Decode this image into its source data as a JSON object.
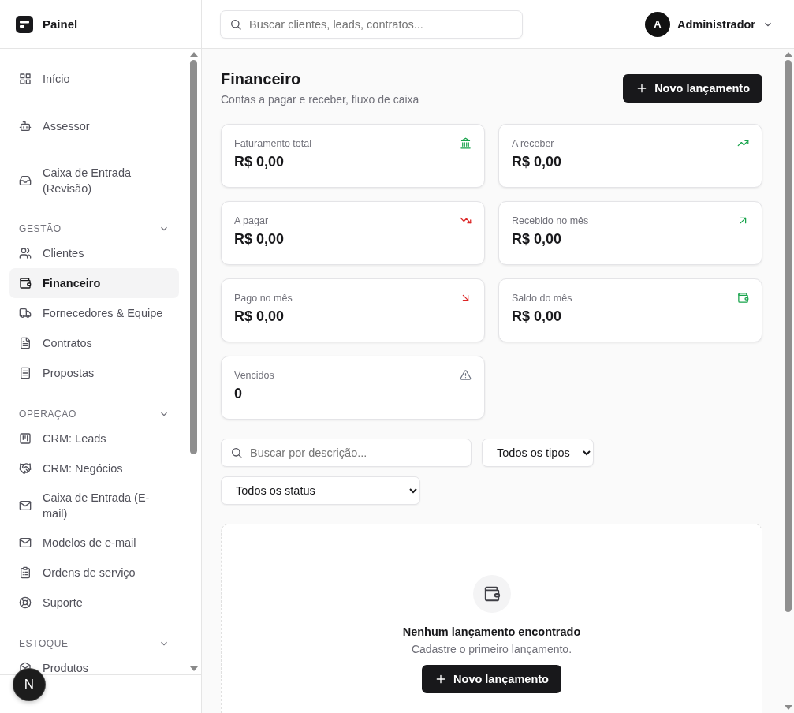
{
  "brand": {
    "name": "Painel"
  },
  "search": {
    "placeholder": "Buscar clientes, leads, contratos..."
  },
  "user": {
    "initial": "A",
    "name": "Administrador"
  },
  "nav": {
    "top_items": [
      {
        "label": "Início",
        "selected": false
      },
      {
        "label": "Assessor",
        "selected": false
      },
      {
        "label": "Caixa de Entrada (Revisão)",
        "selected": false
      }
    ],
    "sections": [
      {
        "title": "GESTÃO",
        "expanded": true,
        "items": [
          {
            "label": "Clientes",
            "selected": false
          },
          {
            "label": "Financeiro",
            "selected": true
          },
          {
            "label": "Fornecedores & Equipe",
            "selected": false
          },
          {
            "label": "Contratos",
            "selected": false
          },
          {
            "label": "Propostas",
            "selected": false
          }
        ]
      },
      {
        "title": "OPERAÇÃO",
        "expanded": true,
        "items": [
          {
            "label": "CRM: Leads",
            "selected": false
          },
          {
            "label": "CRM: Negócios",
            "selected": false
          },
          {
            "label": "Caixa de Entrada (E-mail)",
            "selected": false
          },
          {
            "label": "Modelos de e-mail",
            "selected": false
          },
          {
            "label": "Ordens de serviço",
            "selected": false
          },
          {
            "label": "Suporte",
            "selected": false
          }
        ]
      },
      {
        "title": "ESTOQUE",
        "expanded": true,
        "items": [
          {
            "label": "Produtos",
            "selected": false
          }
        ]
      }
    ]
  },
  "dev_badge": "N",
  "page": {
    "title": "Financeiro",
    "subtitle": "Contas a pagar e receber, fluxo de caixa",
    "new_button": "Novo lançamento"
  },
  "stats": [
    {
      "label": "Faturamento total",
      "value": "R$ 0,00"
    },
    {
      "label": "A receber",
      "value": "R$ 0,00"
    },
    {
      "label": "A pagar",
      "value": "R$ 0,00"
    },
    {
      "label": "Recebido no mês",
      "value": "R$ 0,00"
    },
    {
      "label": "Pago no mês",
      "value": "R$ 0,00"
    },
    {
      "label": "Saldo do mês",
      "value": "R$ 0,00"
    },
    {
      "label": "Vencidos",
      "value": "0"
    }
  ],
  "filters": {
    "search_placeholder": "Buscar por descrição...",
    "type_select": "Todos os tipos",
    "status_select": "Todos os status"
  },
  "empty_state": {
    "title": "Nenhum lançamento encontrado",
    "message": "Cadastre o primeiro lançamento.",
    "button": "Novo lançamento"
  }
}
